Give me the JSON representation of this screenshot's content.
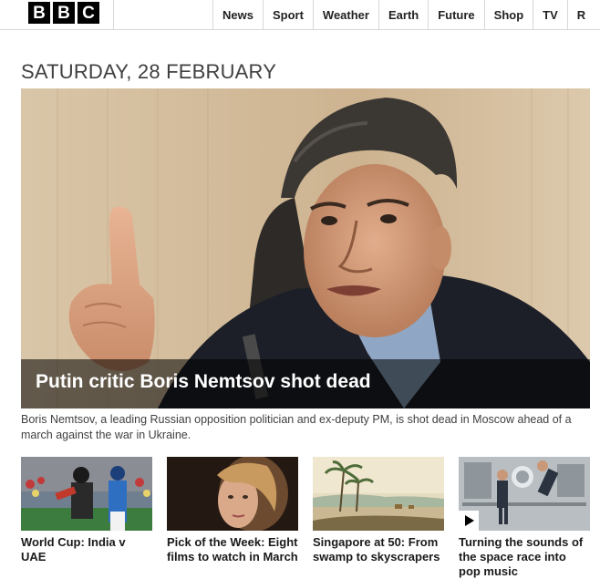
{
  "brand": {
    "letters": [
      "B",
      "B",
      "C"
    ]
  },
  "nav": {
    "items": [
      "News",
      "Sport",
      "Weather",
      "Earth",
      "Future",
      "Shop",
      "TV",
      "R"
    ]
  },
  "date_heading": "Saturday, 28 February",
  "hero": {
    "title": "Putin critic Boris Nemtsov shot dead",
    "summary": "Boris Nemtsov, a leading Russian opposition politician and ex-deputy PM, is shot dead in Moscow ahead of a march against the war in Ukraine."
  },
  "cards": [
    {
      "title": "World Cup: India v UAE",
      "has_video": false
    },
    {
      "title": "Pick of the Week: Eight films to watch in March",
      "has_video": false
    },
    {
      "title": "Singapore at 50: From swamp to skyscrapers",
      "has_video": false
    },
    {
      "title": "Turning the sounds of the space race into pop music",
      "has_video": true
    }
  ],
  "icons": {
    "play": "play-icon"
  },
  "colors": {
    "logo_block": "#000000",
    "caption_overlay": "#000000",
    "heading_text": "#404040"
  }
}
